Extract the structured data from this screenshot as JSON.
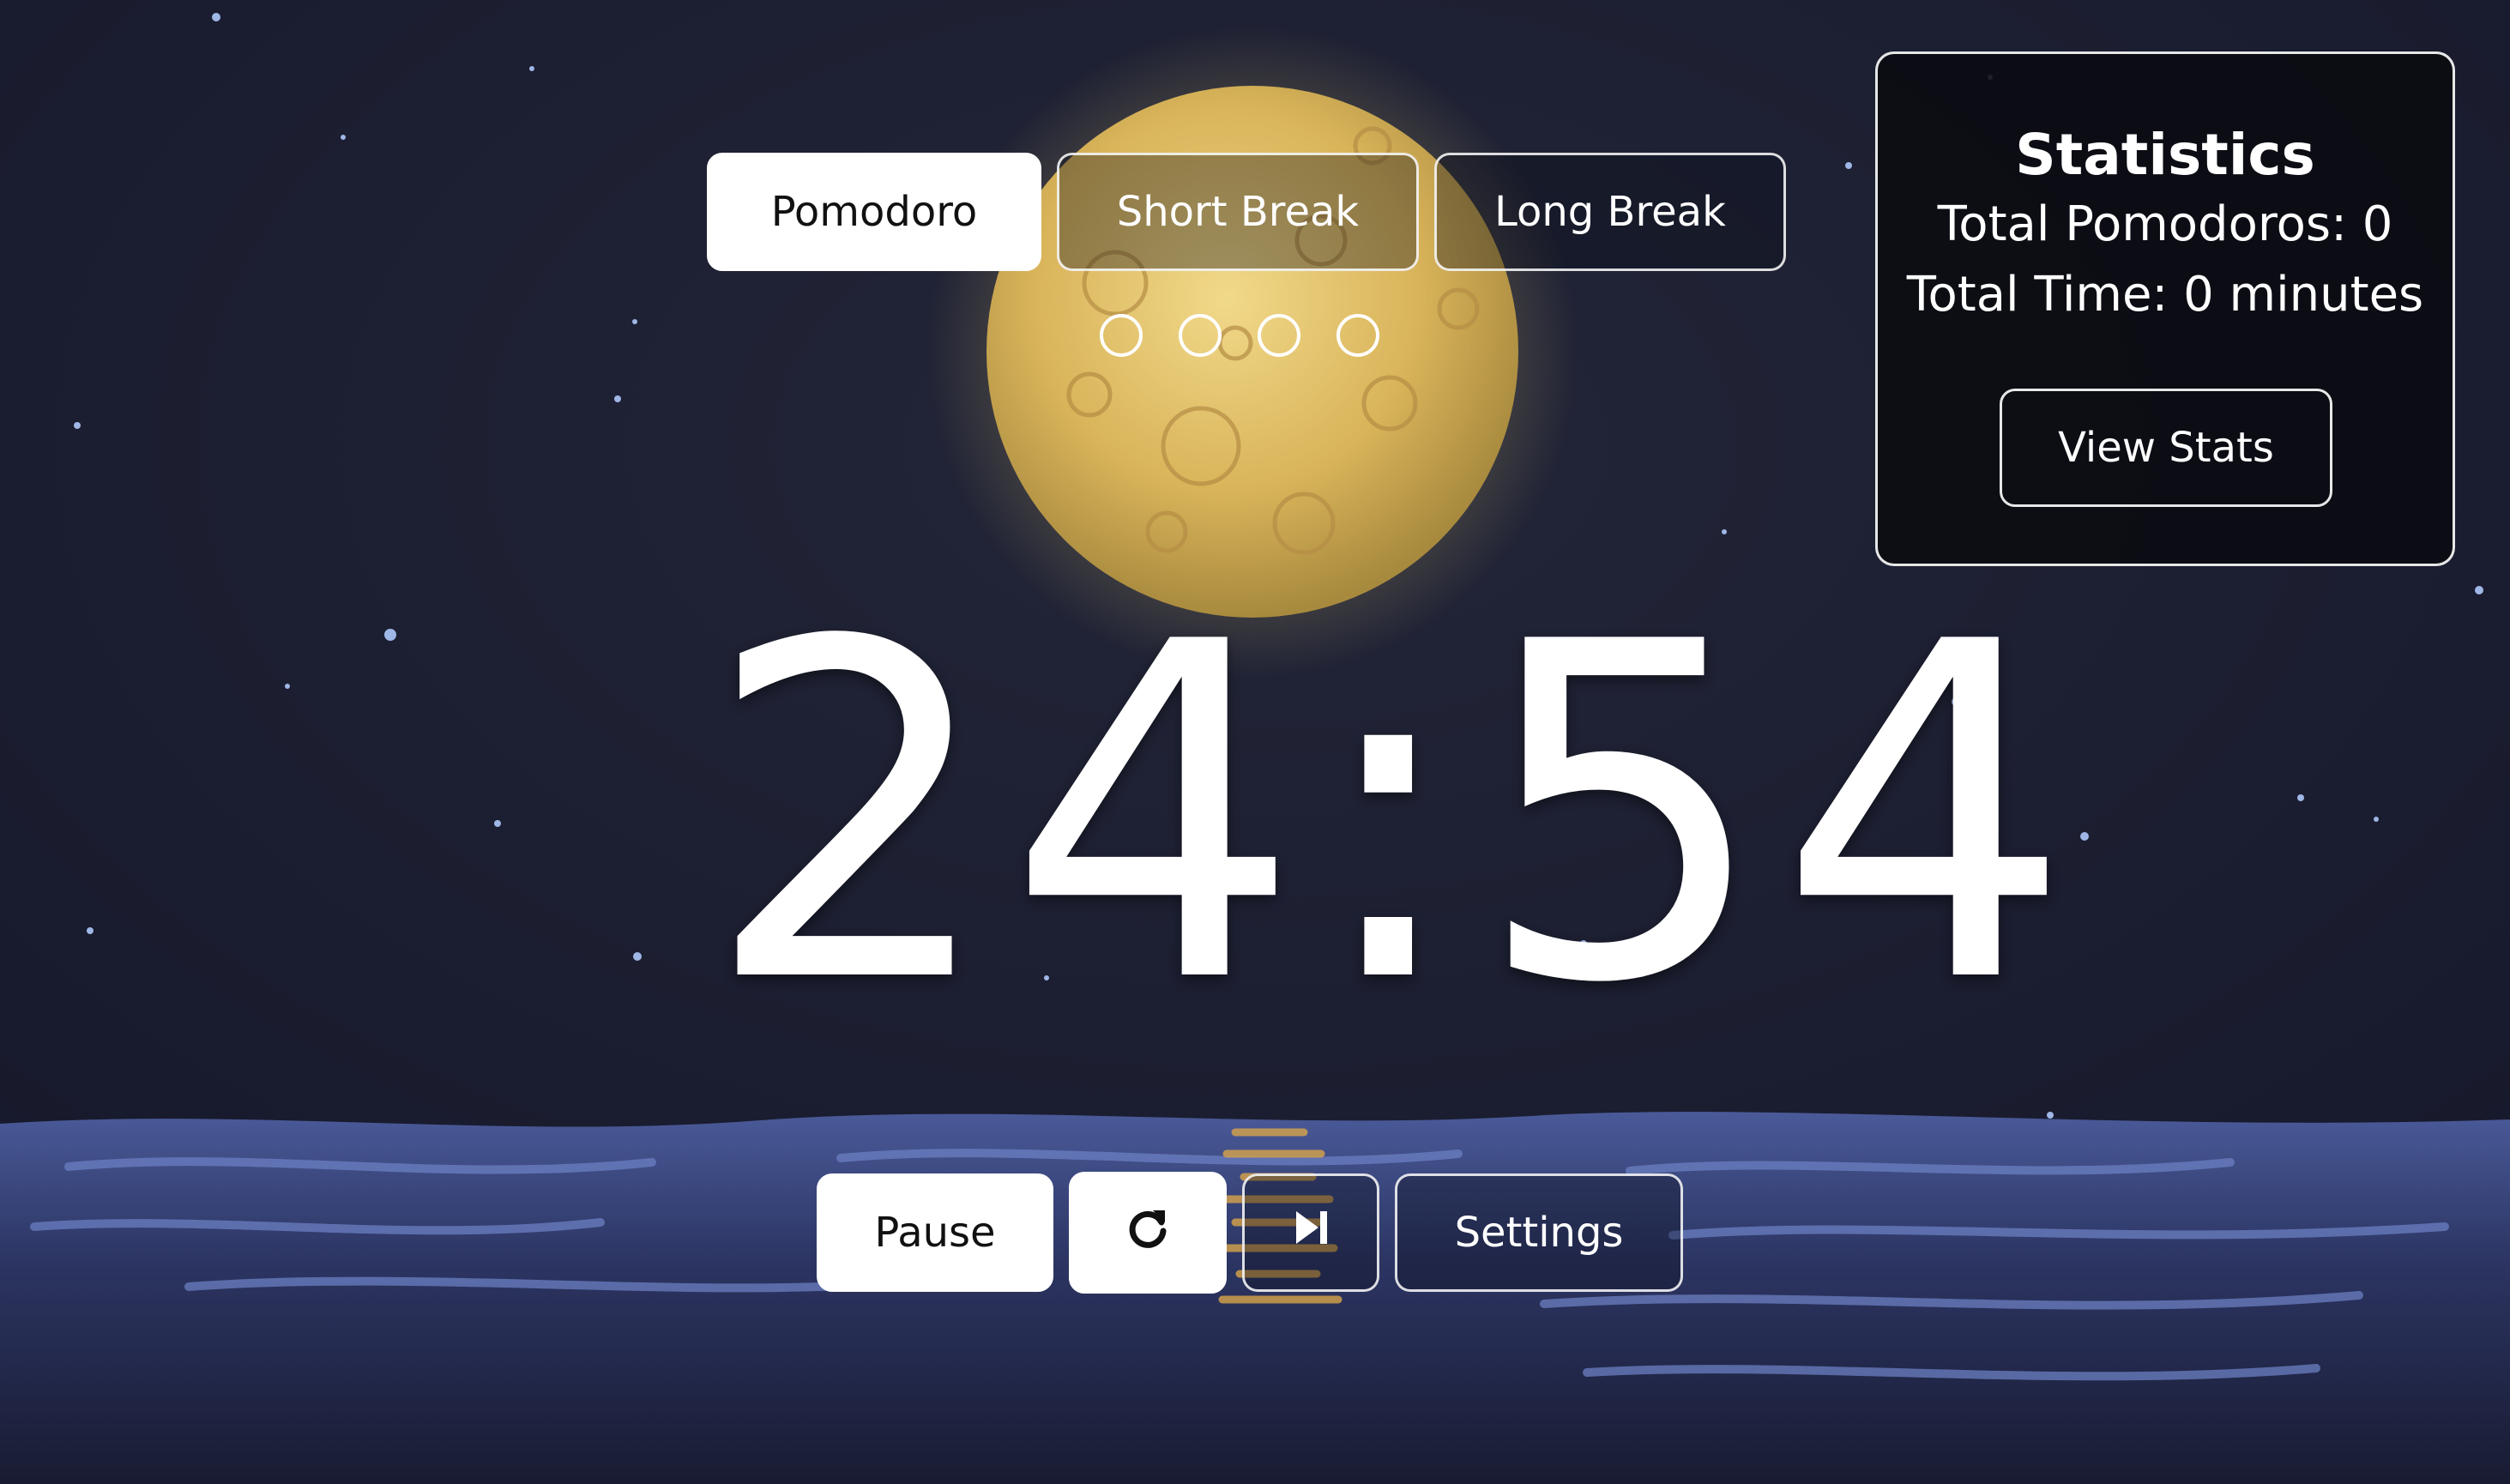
{
  "modes": {
    "pomodoro_label": "Pomodoro",
    "short_break_label": "Short Break",
    "long_break_label": "Long Break",
    "active": "Pomodoro"
  },
  "cycle": {
    "total_sessions": 4,
    "completed_sessions": 0
  },
  "timer": {
    "display": "24:54"
  },
  "controls": {
    "pause_label": "Pause",
    "reset_icon": "reset-icon",
    "skip_icon": "skip-forward-icon",
    "settings_label": "Settings"
  },
  "statistics": {
    "title": "Statistics",
    "total_pomodoros": "Total Pomodoros: 0",
    "total_time": "Total Time: 0 minutes",
    "view_stats_label": "View Stats"
  },
  "colors": {
    "sky": "#1b1d2e",
    "moon": "#e6c56a",
    "sea": "#3f4f8c",
    "button_solid": "#ffffff",
    "text": "#ffffff"
  }
}
